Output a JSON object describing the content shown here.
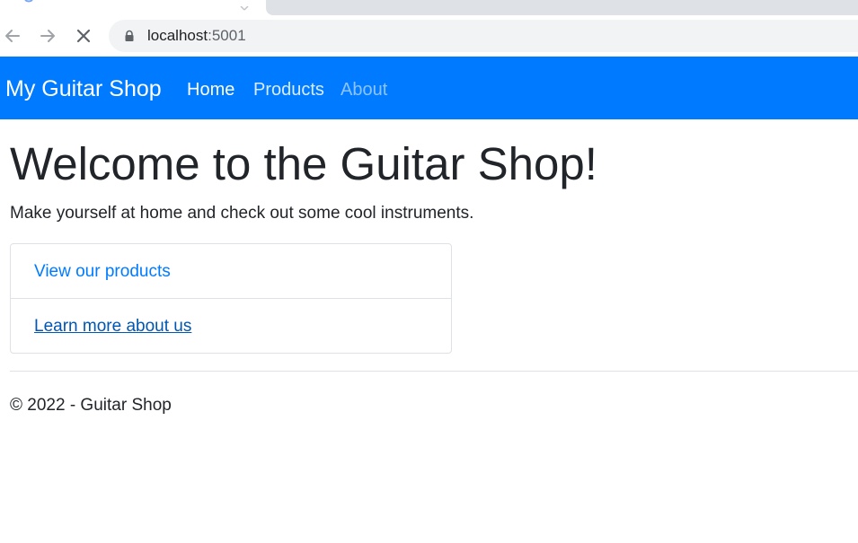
{
  "browser": {
    "url_host": "localhost",
    "url_port": ":5001",
    "colors": {
      "omnibox_bg": "#f1f3f4",
      "tab_inactive_bg": "#dee1e6"
    },
    "icons": {
      "back": "arrow-left-icon",
      "forward": "arrow-right-icon",
      "stop": "close-icon",
      "lock": "lock-icon"
    }
  },
  "navbar": {
    "brand": "My Guitar Shop",
    "links": [
      {
        "label": "Home",
        "state": "active"
      },
      {
        "label": "Products",
        "state": "normal"
      },
      {
        "label": "About",
        "state": "muted"
      }
    ],
    "colors": {
      "background": "#007bff",
      "text": "#ffffff"
    }
  },
  "main": {
    "title": "Welcome to the Guitar Shop!",
    "lead": "Make yourself at home and check out some cool instruments.",
    "list": [
      {
        "label": "View our products"
      },
      {
        "label": "Learn more about us"
      }
    ],
    "colors": {
      "link": "#007bff",
      "link_hover": "#0056b3",
      "border": "#dee2e6"
    }
  },
  "footer": {
    "text": "© 2022 - Guitar Shop"
  }
}
